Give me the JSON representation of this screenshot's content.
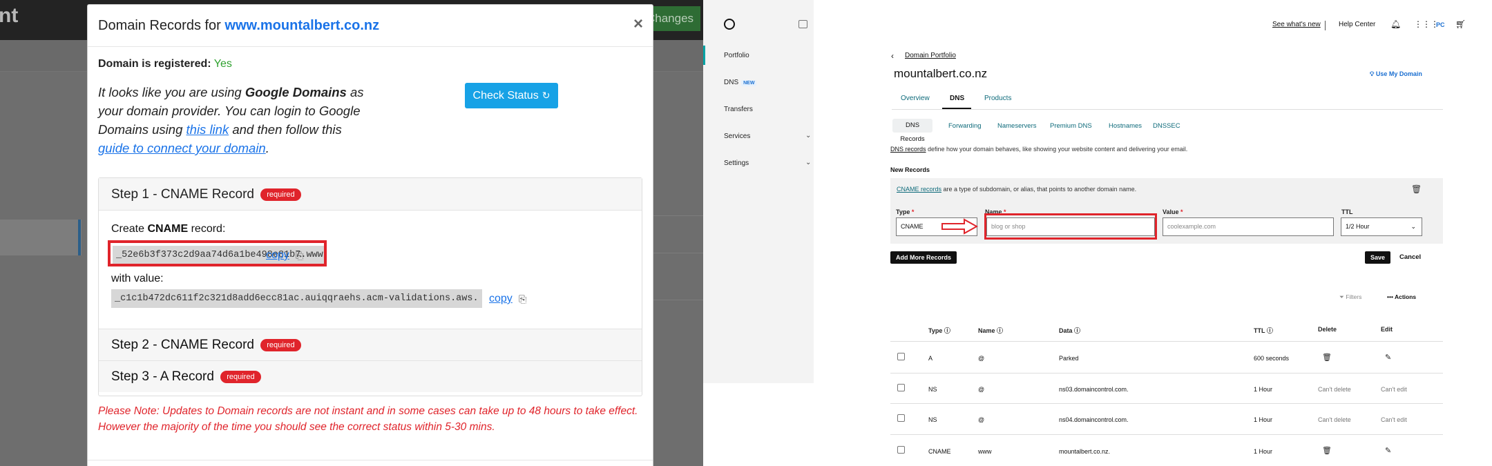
{
  "left": {
    "bg_brand": "nt",
    "bg_changes": "Changes",
    "modal": {
      "title_prefix": "Domain Records for",
      "domain": "www.mountalbert.co.nz",
      "close": "×",
      "registered_label": "Domain is registered:",
      "registered_value": "Yes",
      "intro_1": "It looks like you are using ",
      "intro_provider": "Google Domains",
      "intro_2": " as your domain provider. You can login to Google Domains using ",
      "intro_link1": "this link",
      "intro_3": " and then follow this ",
      "intro_link2": "guide to connect your domain",
      "intro_4": ".",
      "check_button": "Check Status",
      "check_icon": "↻",
      "step1_title": "Step 1 - CNAME Record",
      "required": "required",
      "create_prefix": "Create ",
      "create_bold": "CNAME",
      "create_suffix": " record:",
      "cname_name": "_52e6b3f373c2d9aa74d6a1be498e81b7.www",
      "copy": "copy",
      "copy_icon": "⎘",
      "with_value": "with value:",
      "cname_value": "_c1c1b472dc611f2c321d8add6ecc81ac.auiqqraehs.acm-validations.aws.",
      "step2_title": "Step 2 - CNAME Record",
      "step3_title": "Step 3 - A Record",
      "note_line1": "Please Note: Updates to Domain records are not instant and in some cases can take up to 48 hours to take effect.",
      "note_line2": "However the majority of the time you should see the correct status within 5-30 mins."
    }
  },
  "right": {
    "sidebar": {
      "items": [
        {
          "label": "Portfolio"
        },
        {
          "label": "DNS",
          "badge": "NEW"
        },
        {
          "label": "Transfers"
        },
        {
          "label": "Services"
        },
        {
          "label": "Settings"
        }
      ]
    },
    "topnav": {
      "whats_new": "See what's new",
      "help": "Help Center",
      "initials": "PC"
    },
    "breadcrumb": "Domain Portfolio",
    "domain_title": "mountalbert.co.nz",
    "use_my_domain": "Use My Domain",
    "tabs": [
      "Overview",
      "DNS",
      "Products"
    ],
    "subtabs": [
      "DNS Records",
      "Forwarding",
      "Nameservers",
      "Premium DNS",
      "Hostnames",
      "DNSSEC"
    ],
    "desc_link": "DNS records",
    "desc_text": " define how your domain behaves, like showing your website content and delivering your email.",
    "new_records": "New Records",
    "cname_link": "CNAME records",
    "cname_text": " are a type of subdomain, or alias, that points to another domain name.",
    "form": {
      "type_label": "Type",
      "type_value": "CNAME",
      "name_label": "Name",
      "name_placeholder": "blog or shop",
      "value_label": "Value",
      "value_placeholder": "coolexample.com",
      "ttl_label": "TTL",
      "ttl_value": "1/2 Hour",
      "req": "*"
    },
    "add_more": "Add More Records",
    "save": "Save",
    "cancel": "Cancel",
    "filters": "Filters",
    "actions": "Actions",
    "table": {
      "headers": [
        "Type",
        "Name",
        "Data",
        "TTL",
        "Delete",
        "Edit"
      ],
      "rows": [
        {
          "type": "A",
          "name": "@",
          "data": "Parked",
          "ttl": "600 seconds",
          "delete": "",
          "edit": ""
        },
        {
          "type": "NS",
          "name": "@",
          "data": "ns03.domaincontrol.com.",
          "ttl": "1 Hour",
          "delete": "Can't delete",
          "edit": "Can't edit"
        },
        {
          "type": "NS",
          "name": "@",
          "data": "ns04.domaincontrol.com.",
          "ttl": "1 Hour",
          "delete": "Can't delete",
          "edit": "Can't edit"
        },
        {
          "type": "CNAME",
          "name": "www",
          "data": "mountalbert.co.nz.",
          "ttl": "1 Hour",
          "delete": "",
          "edit": ""
        }
      ]
    }
  }
}
